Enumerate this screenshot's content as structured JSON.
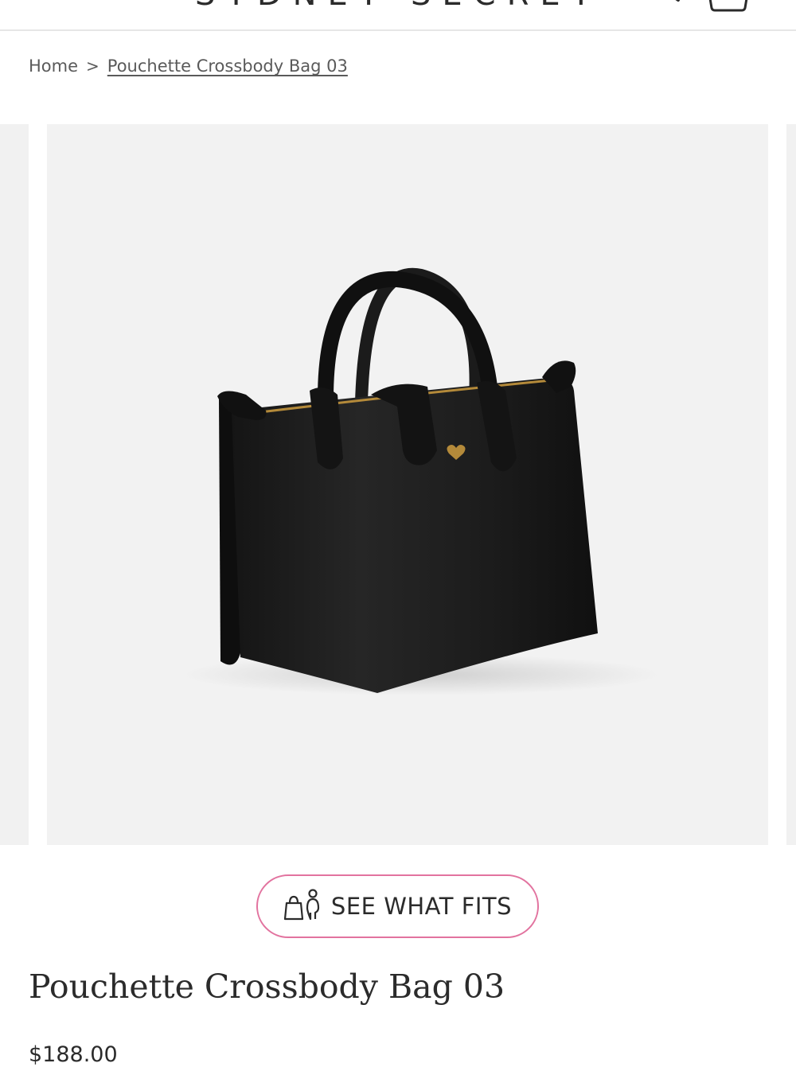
{
  "header": {
    "logo_text": "SYDNEY SECRETS",
    "menu_icon": "hamburger-menu-icon",
    "search_icon": "search-icon",
    "cart_icon": "shopping-bag-icon"
  },
  "breadcrumb": {
    "home": "Home",
    "separator": ">",
    "current": "Pouchette Crossbody Bag 03"
  },
  "gallery": {
    "image_subject": "product-image-black-handbag",
    "active_index": 1
  },
  "fit_button": {
    "label": "SEE WHAT FITS",
    "icon": "bag-and-person-icon",
    "border_color": "#e2739f"
  },
  "product": {
    "title": "Pouchette Crossbody Bag 03",
    "price": "$188.00"
  },
  "colors": {
    "text": "#2b2b2b",
    "accent_pink": "#e2739f",
    "image_background": "#f2f2f2"
  }
}
